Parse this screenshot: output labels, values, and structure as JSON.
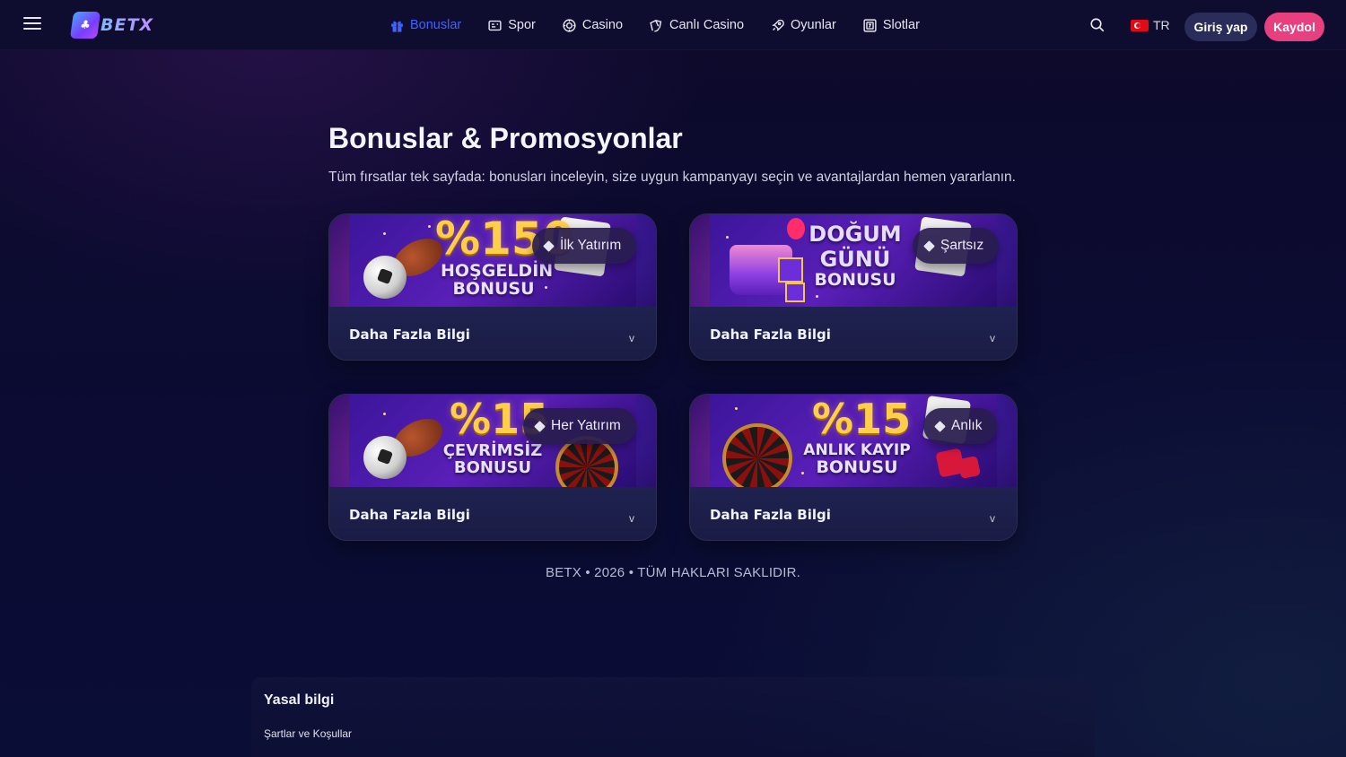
{
  "header": {
    "logo_text": "BETX",
    "nav": [
      {
        "label": "Bonuslar",
        "icon": "gift-icon",
        "active": true
      },
      {
        "label": "Spor",
        "icon": "ticket-icon",
        "active": false
      },
      {
        "label": "Casino",
        "icon": "chip-icon",
        "active": false
      },
      {
        "label": "Canlı Casino",
        "icon": "cards-hand-icon",
        "active": false
      },
      {
        "label": "Oyunlar",
        "icon": "rocket-icon",
        "active": false
      },
      {
        "label": "Slotlar",
        "icon": "slot-icon",
        "active": false
      }
    ],
    "language": "TR",
    "login_label": "Giriş yap",
    "register_label": "Kaydol",
    "colors": {
      "accent": "#3f63ff",
      "register": "#e8407f",
      "login": "#2a2d5a"
    }
  },
  "main": {
    "title": "Bonuslar & Promosyonlar",
    "subtitle": "Tüm fırsatlar tek sayfada: bonusları inceleyin, size uygun kampanyayı seçin ve avantajlardan hemen yararlanın.",
    "cards": [
      {
        "banner_big": "%150",
        "banner_sub_1": "HOŞGELDİN",
        "banner_sub_2": "BONUSU",
        "tag": "İlk Yatırım",
        "more_label": "Daha Fazla Bilgi",
        "chevron": "v"
      },
      {
        "banner_big": "DOĞUM",
        "banner_sub_1": "GÜNÜ",
        "banner_sub_2": "BONUSU",
        "tag": "Şartsız",
        "more_label": "Daha Fazla Bilgi",
        "chevron": "v"
      },
      {
        "banner_big": "%15",
        "banner_sub_1": "ÇEVRİMSİZ",
        "banner_sub_2": "BONUSU",
        "tag": "Her Yatırım",
        "more_label": "Daha Fazla Bilgi",
        "chevron": "v"
      },
      {
        "banner_big": "%15",
        "banner_sub_1": "ANLIK KAYIP",
        "banner_sub_2": "BONUSU",
        "tag": "Anlık",
        "more_label": "Daha Fazla Bilgi",
        "chevron": "v"
      }
    ]
  },
  "footer": {
    "copyright": "BETX • 2026 • TÜM HAKLARI SAKLIDIR.",
    "legal_title": "Yasal bilgi",
    "legal_link": "Şartlar ve Koşullar"
  }
}
